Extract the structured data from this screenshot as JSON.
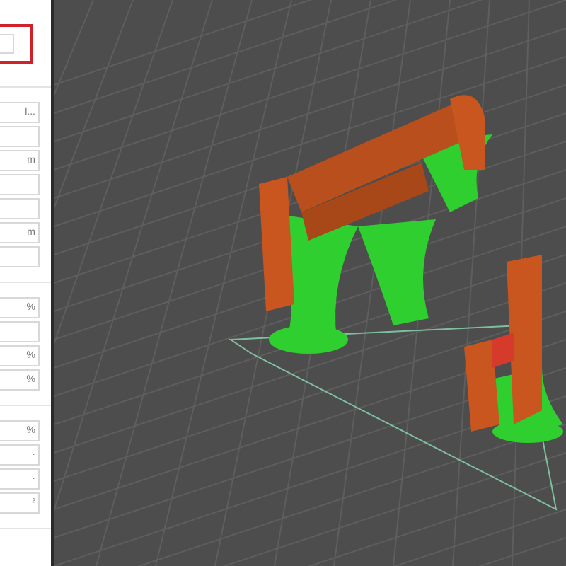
{
  "settings_panel": {
    "sections": [
      {
        "fields": [
          {
            "highlighted": true
          }
        ]
      },
      {
        "fields": [
          {
            "unit": "l...",
            "highlighted": false
          },
          {
            "highlighted": false
          },
          {
            "unit": "m",
            "highlighted": false
          },
          {
            "highlighted": false
          },
          {
            "highlighted": false
          },
          {
            "unit": "m",
            "highlighted": false
          },
          {
            "highlighted": false
          }
        ]
      },
      {
        "fields": [
          {
            "unit": "%",
            "highlighted": false
          },
          {
            "highlighted": false
          },
          {
            "unit": "%",
            "highlighted": false
          },
          {
            "unit": "%",
            "highlighted": false
          }
        ]
      },
      {
        "fields": [
          {
            "unit": "%",
            "highlighted": false
          },
          {
            "unit": "·",
            "highlighted": false
          },
          {
            "unit": "·",
            "highlighted": false
          },
          {
            "unit": "²",
            "highlighted": false
          }
        ]
      }
    ]
  }
}
